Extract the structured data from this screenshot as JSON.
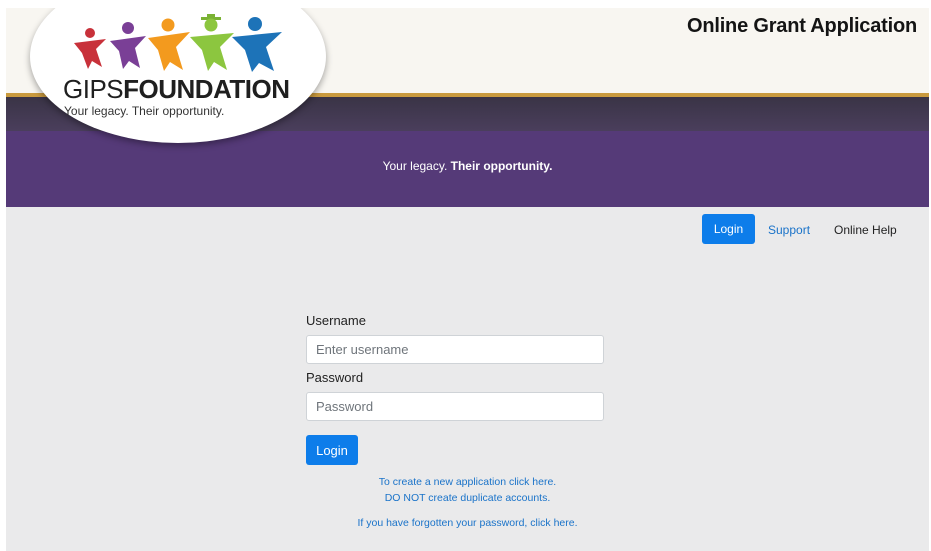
{
  "header": {
    "app_title": "Online Grant Application",
    "logo_name_light": "GIPS",
    "logo_name_bold": "FOUNDATION",
    "logo_tagline": "Your legacy. Their opportunity."
  },
  "banner": {
    "tagline_normal": "Your legacy.",
    "tagline_bold": "Their opportunity."
  },
  "nav": {
    "login": "Login",
    "support": "Support",
    "online_help": "Online Help"
  },
  "form": {
    "username_label": "Username",
    "username_placeholder": "Enter username",
    "password_label": "Password",
    "password_placeholder": "Password",
    "login_button": "Login"
  },
  "links": {
    "create_application": "To create a new application click here.",
    "no_duplicates": "DO NOT create duplicate accounts.",
    "forgot_password": "If you have forgotten your password, click here."
  },
  "colors": {
    "brand_purple": "#553a78",
    "accent_gold": "#c99a3e",
    "primary_blue": "#0d7dea",
    "link_blue": "#1a73c9"
  }
}
